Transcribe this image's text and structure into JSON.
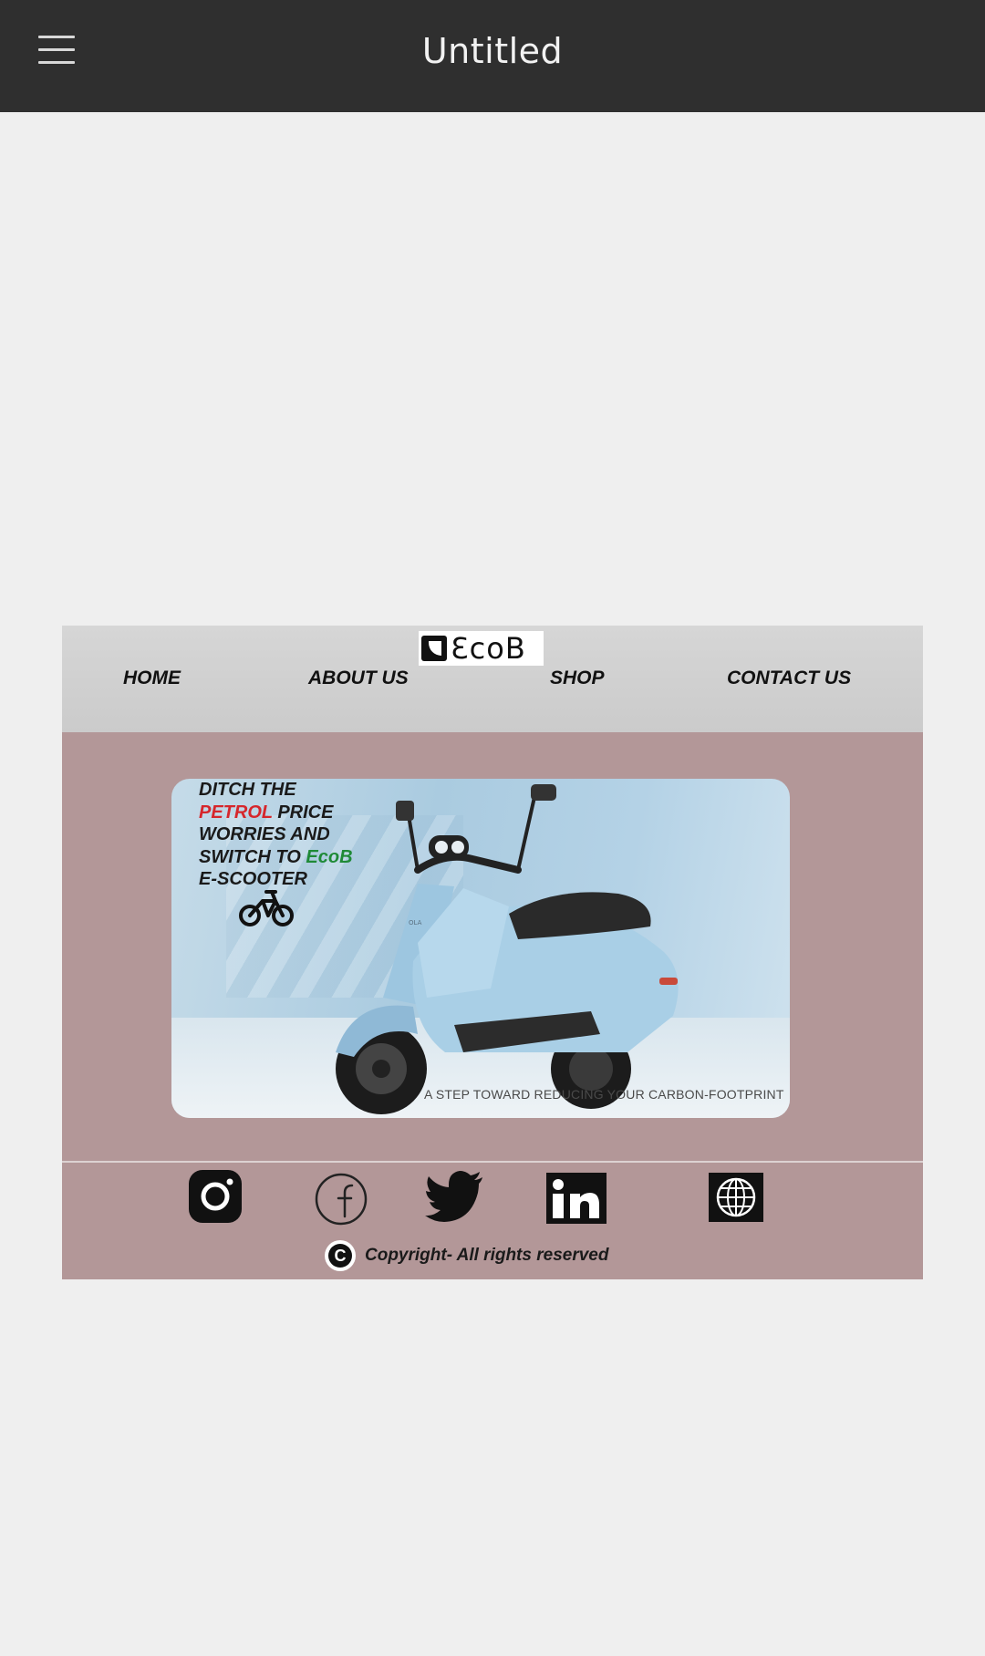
{
  "app_bar": {
    "title": "Untitled",
    "menu_icon": "hamburger-menu-icon"
  },
  "site": {
    "logo": {
      "text": "ƐcoB"
    },
    "nav": [
      {
        "label": "HOME"
      },
      {
        "label": "ABOUT US"
      },
      {
        "label": "SHOP"
      },
      {
        "label": "CONTACT US"
      }
    ],
    "hero": {
      "line1": "DITCH THE",
      "line2_red": "PETROL",
      "line2_rest": " PRICE",
      "line3": "WORRIES AND",
      "line4_a": "SWITCH TO ",
      "line4_green": "EcoB",
      "line5": "E-SCOOTER",
      "tagline": "A STEP TOWARD REDUCING YOUR CARBON-FOOTPRINT",
      "scooter_brand": "OLA"
    },
    "social_icons": [
      "instagram-icon",
      "facebook-icon",
      "twitter-icon",
      "linkedin-icon",
      "globe-icon"
    ],
    "copyright_text": "Copyright- All rights reserved"
  },
  "colors": {
    "app_bar_bg": "#2f2f2f",
    "page_bg": "#efefef",
    "site_bg": "#b39798",
    "nav_bg": "#d0d0d0",
    "accent_red": "#d6262b",
    "accent_green": "#1f8a37"
  }
}
